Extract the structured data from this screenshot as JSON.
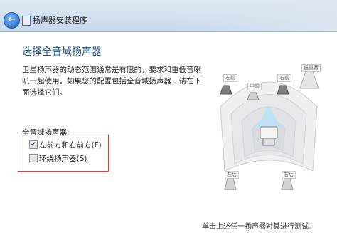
{
  "window": {
    "title": "扬声器安装程序"
  },
  "page": {
    "heading": "选择全音域扬声器",
    "description": "卫星扬声器的动态范围通常是有限的，要求和重低音喇叭一起使用。如果您的配置包括全音域扬声器，请在下面选择它们。",
    "section_label": "全音域扬声器:"
  },
  "options": [
    {
      "label": "左前方和右前方(F)",
      "checked": true
    },
    {
      "label": "环绕扬声器(S)",
      "checked": false
    }
  ],
  "diagram": {
    "labels": {
      "front_left": "左前",
      "center": "中前",
      "front_right": "右前",
      "subwoofer": "低重音",
      "rear_left": "左后",
      "rear_right": "右后"
    }
  },
  "footer": {
    "hint": "单击上述任一扬声器对其进行测试。"
  }
}
